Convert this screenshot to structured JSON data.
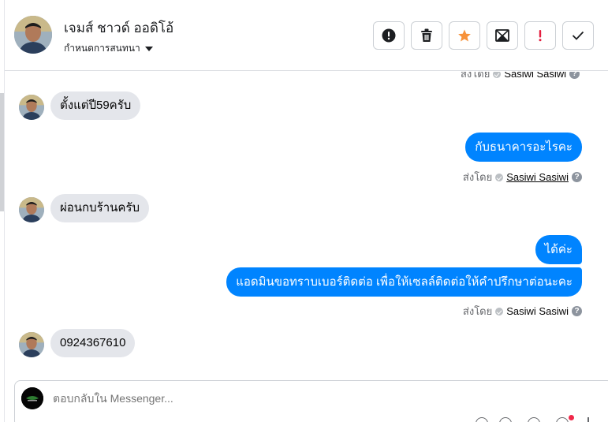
{
  "header": {
    "contact_name": "เจมส์ ชาวด์ ออดิโอ้",
    "assign_label": "กำหนดการสนทนา",
    "actions": [
      {
        "name": "mark-spam",
        "icon": "exclamation-circle-icon"
      },
      {
        "name": "delete",
        "icon": "trash-icon"
      },
      {
        "name": "star",
        "icon": "star-icon",
        "color": "#f7923a"
      },
      {
        "name": "mark-unread",
        "icon": "envelope-icon"
      },
      {
        "name": "follow-up",
        "icon": "exclamation-mark-icon",
        "color": "#e41e3f"
      },
      {
        "name": "mark-done",
        "icon": "checkmark-icon"
      }
    ]
  },
  "messages": {
    "sent_by_prefix": "ส่งโดย",
    "agent_name": "Sasiwi Sasiwi",
    "items": [
      {
        "direction": "in",
        "text": "ตั้งแต่ปี59ครับ"
      },
      {
        "direction": "out",
        "text": "กับธนาคารอะไรคะ"
      },
      {
        "direction": "in",
        "text": "ผ่อนกบร้านครับ"
      },
      {
        "direction": "out",
        "text": "ได้ค่ะ"
      },
      {
        "direction": "out",
        "text": "แอดมินขอทราบเบอร์ติดต่อ เพื่อให้เซลล์ติดต่อให้คำปรึกษาต่อนะคะ"
      },
      {
        "direction": "in",
        "text": "0924367610"
      }
    ]
  },
  "composer": {
    "placeholder": "ตอบกลับใน Messenger..."
  },
  "colors": {
    "outgoing_bubble": "#0084ff",
    "incoming_bubble": "#e4e6eb",
    "accent_star": "#f7923a",
    "alert_red": "#e41e3f"
  }
}
